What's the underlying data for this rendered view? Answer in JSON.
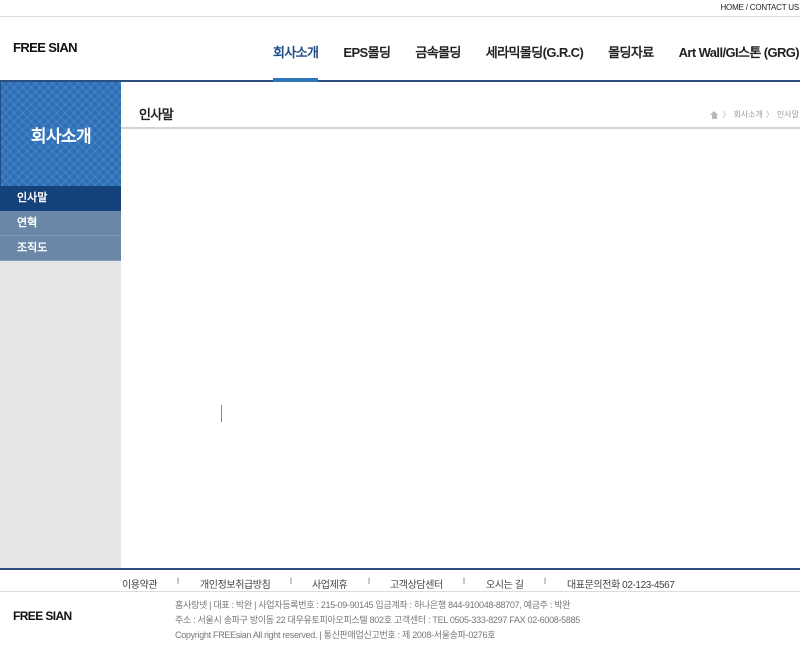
{
  "top_util": {
    "text": "HOME / CONTACT US"
  },
  "header": {
    "logo": "FREE SIAN",
    "gnb": [
      {
        "label": "회사소개"
      },
      {
        "label": "EPS몰딩"
      },
      {
        "label": "금속몰딩"
      },
      {
        "label": "세라믹몰딩(G.R.C)"
      },
      {
        "label": "몰딩자료"
      },
      {
        "label": "Art Wall/GI스톤 (GRG)"
      }
    ]
  },
  "sidebar": {
    "title": "회사소개",
    "items": [
      {
        "label": "인사말"
      },
      {
        "label": "연혁"
      },
      {
        "label": "조직도"
      }
    ]
  },
  "content": {
    "page_title": "인사말",
    "breadcrumb": [
      "회사소개",
      "인사말"
    ],
    "breadcrumb_sep": "〉"
  },
  "footer": {
    "nav": [
      {
        "label": "이용약관"
      },
      {
        "label": "개인정보취급방침"
      },
      {
        "label": "사업제휴"
      },
      {
        "label": "고객상담센터"
      },
      {
        "label": "오시는 길"
      },
      {
        "label": "대표문의전화 02-123-4567"
      }
    ],
    "nav_sep": "l",
    "logo": "FREE SIAN",
    "info": [
      "홈사랑넷  |  대표 : 박완  |  사업자등록번호 : 215-09-90145  입금계좌 : 하나은행 844-910048-88707, 예금주 : 박완",
      "주소 : 서울시 송파구 방이동 22 대우유토피아오피스텔 802호  고객센터 : TEL 0505-333-8297    FAX 02-6008-5885",
      "Copyright FREEsian All right reserved.  |  통신판매업신고번호 : 제 2008-서울송파-0276호"
    ]
  },
  "colors": {
    "navy": "#2d4f80",
    "accent_blue": "#2f76b8",
    "side_title_bg": "#2c6fb8",
    "lnb_active": "#15427a",
    "lnb_default": "#6a87a7",
    "side_bg": "#e6e6e6"
  }
}
